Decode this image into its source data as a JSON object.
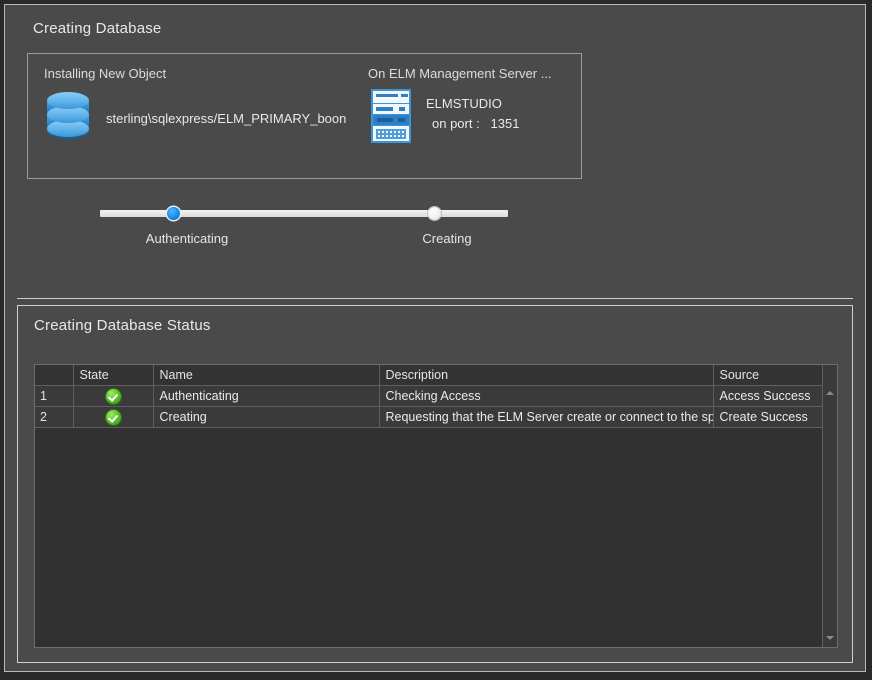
{
  "window": {
    "frame_color": "#2a2a2a",
    "panel_background": "#4a4a4a"
  },
  "creating_database_panel": {
    "title": "Creating Database",
    "install_box": {
      "left_label": "Installing New Object",
      "right_label": "On ELM Management Server ...",
      "database_icon": "database-cylinder-icon",
      "database_name": "sterling\\sqlexpress/ELM_PRIMARY_boon",
      "server_icon": "server-rack-icon",
      "server_name": "ELMSTUDIO",
      "server_port_label": "on port :",
      "server_port_value": "1351"
    },
    "progress": {
      "stages": [
        {
          "label": "Authenticating",
          "active": true,
          "color": "#0f8ce8",
          "position_pct": 17
        },
        {
          "label": "Creating",
          "active": false,
          "color": "#ffffff",
          "position_pct": 81
        }
      ],
      "track_color": "#e9e9e9"
    }
  },
  "creating_status_panel": {
    "title": "Creating Database Status",
    "grid": {
      "columns": [
        "",
        "State",
        "Name",
        "Description",
        "Source"
      ],
      "rows": [
        {
          "num": "1",
          "state_icon": "green-check-icon",
          "name": "Authenticating",
          "description": "Checking Access",
          "source": "Access Success"
        },
        {
          "num": "2",
          "state_icon": "green-check-icon",
          "name": "Creating",
          "description": "Requesting that the ELM Server create or connect to the specif",
          "source": "Create Success"
        }
      ]
    },
    "scrollbar": {
      "up_arrow": "scroll-up-arrow-icon",
      "down_arrow": "scroll-down-arrow-icon"
    }
  }
}
